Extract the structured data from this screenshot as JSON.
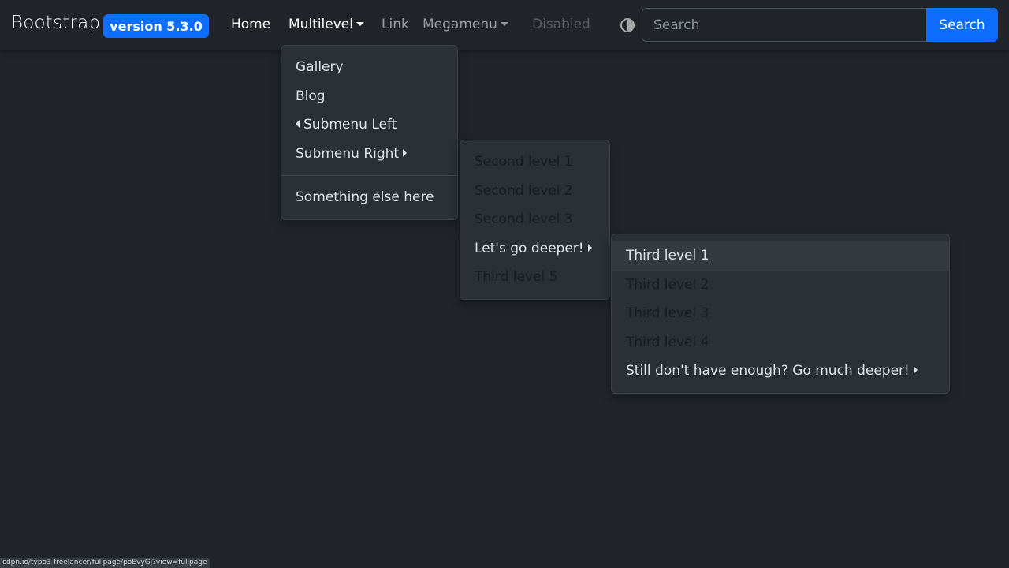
{
  "navbar": {
    "brand": "Bootstrap",
    "version_badge": "version 5.3.0",
    "links": {
      "home": "Home",
      "multilevel": "Multilevel",
      "link": "Link",
      "megamenu": "Megamenu",
      "disabled": "Disabled"
    },
    "search": {
      "placeholder": "Search",
      "button": "Search"
    }
  },
  "menu_level1": {
    "items": [
      "Gallery",
      "Blog",
      "Submenu Left",
      "Submenu Right"
    ],
    "after_divider": "Something else here"
  },
  "menu_level2": {
    "items": [
      "Second level 1",
      "Second level 2",
      "Second level 3",
      "Let's go deeper!",
      "Third level 5"
    ]
  },
  "menu_level3": {
    "items": [
      "Third level 1",
      "Third level 2",
      "Third level 3",
      "Third level 4",
      "Still don't have enough? Go much deeper!"
    ]
  },
  "status_url": "cdpn.io/typo3-freelancer/fullpage/poEvyGj?view=fullpage",
  "colors": {
    "background": "#212529",
    "accent": "#0d6efd",
    "menu_bg": "#2b3035"
  }
}
